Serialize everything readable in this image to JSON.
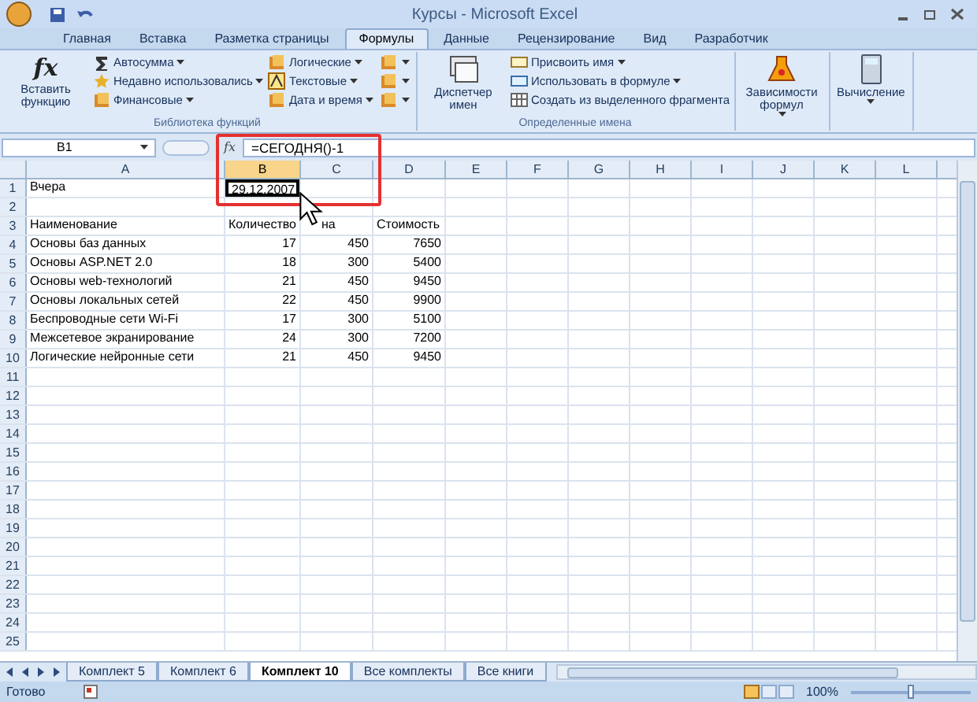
{
  "window": {
    "title": "Курсы - Microsoft Excel"
  },
  "tabs": [
    {
      "label": "Главная",
      "selected": false
    },
    {
      "label": "Вставка",
      "selected": false
    },
    {
      "label": "Разметка страницы",
      "selected": false
    },
    {
      "label": "Формулы",
      "selected": true
    },
    {
      "label": "Данные",
      "selected": false
    },
    {
      "label": "Рецензирование",
      "selected": false
    },
    {
      "label": "Вид",
      "selected": false
    },
    {
      "label": "Разработчик",
      "selected": false
    }
  ],
  "ribbon": {
    "groups": [
      {
        "label": "Библиотека функций",
        "big": {
          "label": "Вставить функцию",
          "glyph": "fx"
        },
        "columns": [
          [
            {
              "label": "Автосумма"
            },
            {
              "label": "Недавно использовались"
            },
            {
              "label": "Финансовые"
            }
          ],
          [
            {
              "label": "Логические"
            },
            {
              "label": "Текстовые"
            },
            {
              "label": "Дата и время"
            }
          ],
          [
            {
              "kind": "icon"
            },
            {
              "kind": "icon"
            },
            {
              "kind": "icon"
            }
          ]
        ]
      },
      {
        "label": "Определенные имена",
        "big": {
          "label": "Диспетчер имен"
        },
        "columns": [
          [
            {
              "label": "Присвоить имя"
            },
            {
              "label": "Использовать в формуле"
            },
            {
              "label": "Создать из выделенного фрагмента"
            }
          ]
        ]
      },
      {
        "big": {
          "label": "Зависимости формул"
        }
      },
      {
        "big": {
          "label": "Вычисление"
        }
      }
    ]
  },
  "formula_bar": {
    "name_box": "B1",
    "glyph": "fx",
    "formula": "=СЕГОДНЯ()-1"
  },
  "columns": [
    {
      "label": "A",
      "selected": false
    },
    {
      "label": "B",
      "selected": true
    },
    {
      "label": "C",
      "selected": false
    },
    {
      "label": "D",
      "selected": false
    },
    {
      "label": "E",
      "selected": false
    },
    {
      "label": "F",
      "selected": false
    },
    {
      "label": "G",
      "selected": false
    },
    {
      "label": "H",
      "selected": false
    },
    {
      "label": "I",
      "selected": false
    },
    {
      "label": "J",
      "selected": false
    },
    {
      "label": "K",
      "selected": false
    },
    {
      "label": "L",
      "selected": false
    }
  ],
  "rows": [
    {
      "number": "1",
      "cells": [
        {
          "text": "Вчера",
          "kind": "text",
          "selected": false
        },
        {
          "text": "29.12.2007",
          "kind": "number",
          "selected": true
        }
      ]
    },
    {
      "number": "2"
    },
    {
      "number": "3",
      "cells": [
        {
          "text": "Наименование",
          "kind": "text",
          "selected": false
        },
        {
          "text": "Количество",
          "kind": "text",
          "selected": false
        },
        {
          "text": "на",
          "kind": "covered",
          "selected": false
        },
        {
          "text": "Стоимость",
          "kind": "text",
          "selected": false
        }
      ]
    },
    {
      "number": "4",
      "cells": [
        {
          "text": "Основы баз данных",
          "kind": "text",
          "selected": false
        },
        {
          "text": "17",
          "kind": "number",
          "selected": false
        },
        {
          "text": "450",
          "kind": "number",
          "selected": false
        },
        {
          "text": "7650",
          "kind": "number",
          "selected": false
        }
      ]
    },
    {
      "number": "5",
      "cells": [
        {
          "text": "Основы ASP.NET 2.0",
          "kind": "text",
          "selected": false
        },
        {
          "text": "18",
          "kind": "number",
          "selected": false
        },
        {
          "text": "300",
          "kind": "number",
          "selected": false
        },
        {
          "text": "5400",
          "kind": "number",
          "selected": false
        }
      ]
    },
    {
      "number": "6",
      "cells": [
        {
          "text": "Основы web-технологий",
          "kind": "text",
          "selected": false
        },
        {
          "text": "21",
          "kind": "number",
          "selected": false
        },
        {
          "text": "450",
          "kind": "number",
          "selected": false
        },
        {
          "text": "9450",
          "kind": "number",
          "selected": false
        }
      ]
    },
    {
      "number": "7",
      "cells": [
        {
          "text": "Основы локальных сетей",
          "kind": "text",
          "selected": false
        },
        {
          "text": "22",
          "kind": "number",
          "selected": false
        },
        {
          "text": "450",
          "kind": "number",
          "selected": false
        },
        {
          "text": "9900",
          "kind": "number",
          "selected": false
        }
      ]
    },
    {
      "number": "8",
      "cells": [
        {
          "text": "Беспроводные сети Wi-Fi",
          "kind": "text",
          "selected": false
        },
        {
          "text": "17",
          "kind": "number",
          "selected": false
        },
        {
          "text": "300",
          "kind": "number",
          "selected": false
        },
        {
          "text": "5100",
          "kind": "number",
          "selected": false
        }
      ]
    },
    {
      "number": "9",
      "cells": [
        {
          "text": "Межсетевое экранирование",
          "kind": "text",
          "selected": false
        },
        {
          "text": "24",
          "kind": "number",
          "selected": false
        },
        {
          "text": "300",
          "kind": "number",
          "selected": false
        },
        {
          "text": "7200",
          "kind": "number",
          "selected": false
        }
      ]
    },
    {
      "number": "10",
      "cells": [
        {
          "text": "Логические нейронные сети",
          "kind": "text",
          "selected": false
        },
        {
          "text": "21",
          "kind": "number",
          "selected": false
        },
        {
          "text": "450",
          "kind": "number",
          "selected": false
        },
        {
          "text": "9450",
          "kind": "number",
          "selected": false
        }
      ]
    },
    {
      "number": "11"
    },
    {
      "number": "12"
    },
    {
      "number": "13"
    },
    {
      "number": "14"
    },
    {
      "number": "15"
    },
    {
      "number": "16"
    },
    {
      "number": "17"
    },
    {
      "number": "18"
    },
    {
      "number": "19"
    },
    {
      "number": "20"
    },
    {
      "number": "21"
    },
    {
      "number": "22"
    },
    {
      "number": "23"
    },
    {
      "number": "24"
    },
    {
      "number": "25"
    }
  ],
  "sheet_tabs": [
    {
      "label": "Комплект 5",
      "selected": false
    },
    {
      "label": "Комплект 6",
      "selected": false
    },
    {
      "label": "Комплект 10",
      "selected": true
    },
    {
      "label": "Все комплекты",
      "selected": false
    },
    {
      "label": "Все книги",
      "selected": false
    }
  ],
  "status_bar": {
    "status": "Готово",
    "zoom": "100%",
    "zoom_slider": {
      "level": 0.5
    }
  }
}
